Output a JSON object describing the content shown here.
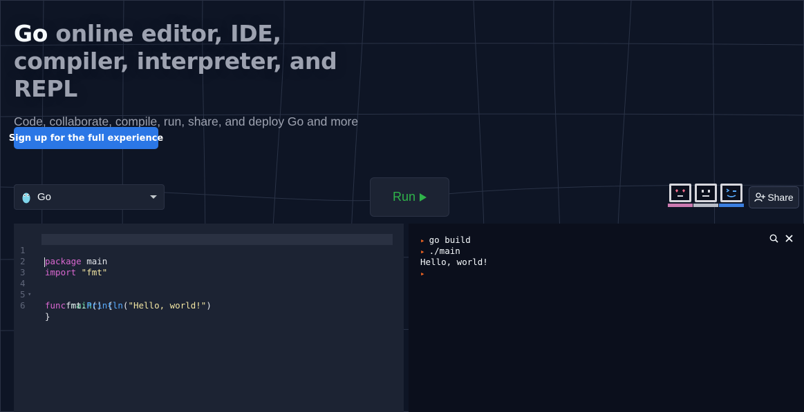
{
  "hero": {
    "title_lang": "Go",
    "title_rest": " online editor, IDE, compiler, interpreter, and REPL",
    "subtitle": "Code, collaborate, compile, run, share, and deploy Go and more online from your browser",
    "cta_label": "Sign up for the full experience"
  },
  "toolbar": {
    "language": "Go",
    "run_label": "Run",
    "share_label": "Share"
  },
  "editor": {
    "lines": [
      {
        "num": "1",
        "fold": ""
      },
      {
        "num": "2",
        "fold": ""
      },
      {
        "num": "3",
        "fold": ""
      },
      {
        "num": "4",
        "fold": "▾"
      },
      {
        "num": "5",
        "fold": ""
      },
      {
        "num": "6",
        "fold": ""
      }
    ],
    "tokens": {
      "l1_kw": "package",
      "l1_rest": " main",
      "l2_kw": "import",
      "l2_str": " \"fmt\"",
      "l4_kw": "func",
      "l4_fn": " main",
      "l4_rest": "() {",
      "l5_pre": "    fmt.",
      "l5_meth": "Println",
      "l5_open": "(",
      "l5_str": "\"Hello, world!\"",
      "l5_close": ")",
      "l6": "}"
    }
  },
  "console": {
    "lines": [
      {
        "prompt": true,
        "text": "go build"
      },
      {
        "prompt": true,
        "text": "./main"
      },
      {
        "prompt": false,
        "text": "Hello, world!"
      },
      {
        "prompt": true,
        "text": ""
      }
    ],
    "prompt_glyph": "▸"
  },
  "icons": {
    "gopher": "go-gopher-icon",
    "chevron": "chevron-down-icon",
    "play": "play-icon",
    "share": "add-user-icon",
    "search": "search-icon",
    "close": "close-icon",
    "avatars": [
      "heart-eyes-computer-icon",
      "neutral-computer-icon",
      "wink-computer-icon"
    ]
  },
  "colors": {
    "background": "#0e1525",
    "panel": "#1c2333",
    "console": "#0b0f1c",
    "accent": "#2b77e6",
    "run": "#2fb34a",
    "prompt": "#f26522"
  }
}
